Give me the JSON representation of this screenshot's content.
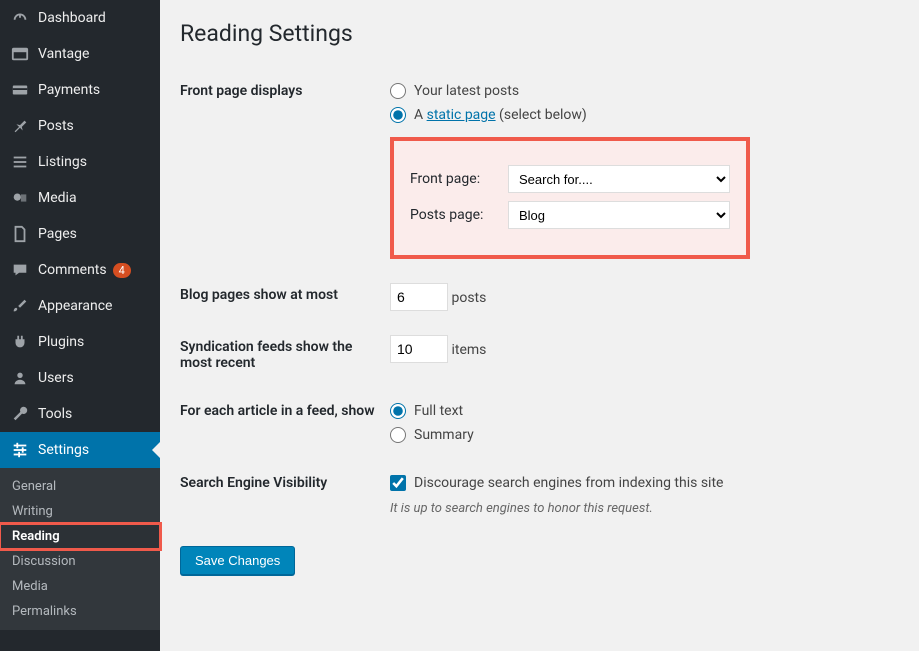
{
  "sidebar": {
    "items": [
      {
        "label": "Dashboard",
        "icon": "dashboard"
      },
      {
        "label": "Vantage",
        "icon": "vantage"
      },
      {
        "label": "Payments",
        "icon": "payments"
      },
      {
        "label": "Posts",
        "icon": "pin"
      },
      {
        "label": "Listings",
        "icon": "list"
      },
      {
        "label": "Media",
        "icon": "media"
      },
      {
        "label": "Pages",
        "icon": "page"
      },
      {
        "label": "Comments",
        "icon": "comment",
        "badge": "4"
      },
      {
        "label": "Appearance",
        "icon": "brush"
      },
      {
        "label": "Plugins",
        "icon": "plug"
      },
      {
        "label": "Users",
        "icon": "user"
      },
      {
        "label": "Tools",
        "icon": "wrench"
      },
      {
        "label": "Settings",
        "icon": "sliders",
        "active": true
      }
    ],
    "submenu": [
      {
        "label": "General"
      },
      {
        "label": "Writing"
      },
      {
        "label": "Reading",
        "active": true,
        "highlighted": true
      },
      {
        "label": "Discussion"
      },
      {
        "label": "Media"
      },
      {
        "label": "Permalinks"
      }
    ]
  },
  "page": {
    "title": "Reading Settings",
    "frontpage_heading": "Front page displays",
    "radio_latest_label": "Your latest posts",
    "radio_static_prefix": "A ",
    "radio_static_link": "static page",
    "radio_static_suffix": " (select below)",
    "radio_selected": "static",
    "front_page_label": "Front page:",
    "front_page_value": "Search for....",
    "posts_page_label": "Posts page:",
    "posts_page_value": "Blog",
    "blog_pages_heading": "Blog pages show at most",
    "blog_pages_value": "6",
    "blog_pages_unit": "posts",
    "syndication_heading": "Syndication feeds show the most recent",
    "syndication_value": "10",
    "syndication_unit": "items",
    "feed_heading": "For each article in a feed, show",
    "feed_full_label": "Full text",
    "feed_summary_label": "Summary",
    "feed_selected": "full",
    "sev_heading": "Search Engine Visibility",
    "sev_checkbox_label": "Discourage search engines from indexing this site",
    "sev_checked": true,
    "sev_desc": "It is up to search engines to honor this request.",
    "save_label": "Save Changes"
  }
}
